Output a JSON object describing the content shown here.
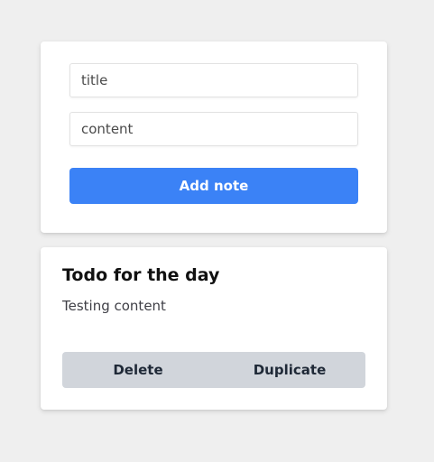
{
  "form": {
    "title_placeholder": "title",
    "content_placeholder": "content",
    "add_label": "Add note"
  },
  "note": {
    "title": "Todo for the day",
    "content": "Testing content",
    "delete_label": "Delete",
    "duplicate_label": "Duplicate"
  },
  "colors": {
    "background": "#efefef",
    "card": "#ffffff",
    "primary_button": "#3b82f6",
    "action_bar": "#d1d5db"
  }
}
